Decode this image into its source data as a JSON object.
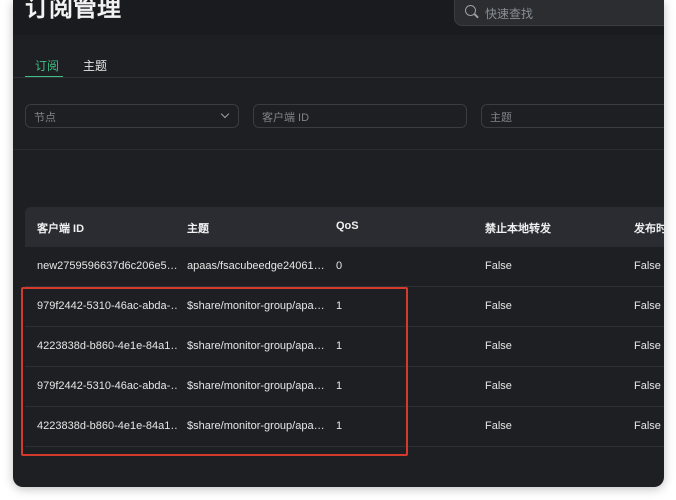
{
  "header": {
    "title": "订阅管理",
    "search_placeholder": "快速查找"
  },
  "tabs": [
    {
      "label": "订阅",
      "active": true
    },
    {
      "label": "主题",
      "active": false
    }
  ],
  "filters": {
    "node_placeholder": "节点",
    "client_id_placeholder": "客户端 ID",
    "topic_placeholder": "主题"
  },
  "table": {
    "columns": [
      "客户端 ID",
      "主题",
      "QoS",
      "禁止本地转发",
      "发布时"
    ],
    "rows": [
      [
        "new2759596637d6c206e5…",
        "apaas/fsacubeedge24061…",
        "0",
        "False",
        "False"
      ],
      [
        "979f2442-5310-46ac-abda-…",
        "$share/monitor-group/apa…",
        "1",
        "False",
        "False"
      ],
      [
        "4223838d-b860-4e1e-84a1…",
        "$share/monitor-group/apa…",
        "1",
        "False",
        "False"
      ],
      [
        "979f2442-5310-46ac-abda-…",
        "$share/monitor-group/apa…",
        "1",
        "False",
        "False"
      ],
      [
        "4223838d-b860-4e1e-84a1…",
        "$share/monitor-group/apa…",
        "1",
        "False",
        "False"
      ]
    ]
  },
  "colors": {
    "accent": "#3fbf86",
    "highlight": "#d33a2c",
    "background": "#1e1f22"
  }
}
